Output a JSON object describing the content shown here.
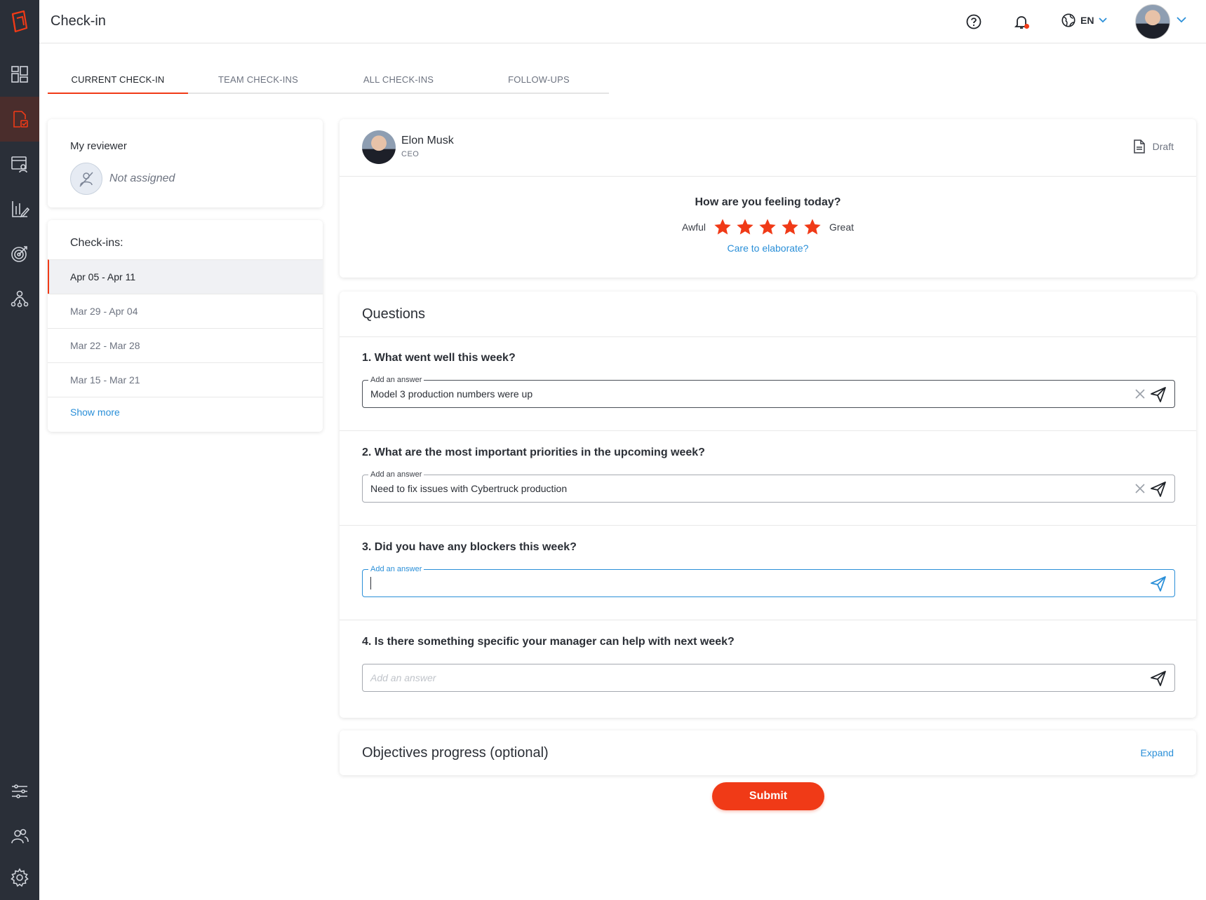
{
  "app": {
    "title": "Check-in",
    "language": "EN"
  },
  "colors": {
    "accent": "#f03a17",
    "link": "#2a8fd8",
    "sidebar": "#2a2f38"
  },
  "sidebar": {
    "items": [
      {
        "icon": "dashboard-icon"
      },
      {
        "icon": "check-in-icon",
        "active": true
      },
      {
        "icon": "one-on-one-icon"
      },
      {
        "icon": "reports-icon"
      },
      {
        "icon": "objectives-icon"
      },
      {
        "icon": "org-chart-icon"
      }
    ],
    "bottom_items": [
      {
        "icon": "filters-icon"
      },
      {
        "icon": "people-icon"
      },
      {
        "icon": "settings-icon"
      }
    ]
  },
  "tabs": [
    {
      "label": "CURRENT CHECK-IN",
      "active": true
    },
    {
      "label": "TEAM CHECK-INS"
    },
    {
      "label": "ALL CHECK-INS"
    },
    {
      "label": "FOLLOW-UPS"
    }
  ],
  "reviewer": {
    "title": "My reviewer",
    "name": "Not assigned"
  },
  "checkins": {
    "title": "Check-ins:",
    "items": [
      {
        "label": "Apr 05 - Apr 11",
        "active": true
      },
      {
        "label": "Mar 29 - Apr 04"
      },
      {
        "label": "Mar 22 - Mar 28"
      },
      {
        "label": "Mar 15 - Mar 21"
      }
    ],
    "show_more": "Show more"
  },
  "profile": {
    "name": "Elon Musk",
    "role": "CEO",
    "status": "Draft"
  },
  "mood": {
    "question": "How are you feeling today?",
    "low_label": "Awful",
    "high_label": "Great",
    "rating": 5,
    "max": 5,
    "elaborate": "Care to elaborate?"
  },
  "questions": {
    "title": "Questions",
    "items": [
      {
        "text": "1. What went well this week?",
        "label": "Add an answer",
        "value": "Model 3 production numbers were up",
        "state": "filled"
      },
      {
        "text": "2. What are the most important priorities in the upcoming week?",
        "label": "Add an answer",
        "value": "Need to fix issues with Cybertruck production",
        "state": "filled"
      },
      {
        "text": "3. Did you have any blockers this week?",
        "label": "Add an answer",
        "value": "",
        "state": "focus"
      },
      {
        "text": "4. Is there something specific your manager can help with next week?",
        "placeholder": "Add an answer",
        "value": "",
        "state": "empty"
      }
    ]
  },
  "objectives": {
    "title": "Objectives progress (optional)",
    "expand": "Expand"
  },
  "submit": "Submit"
}
